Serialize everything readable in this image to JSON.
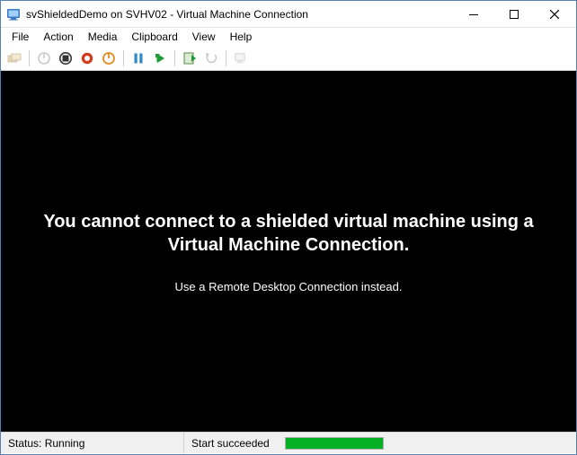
{
  "window": {
    "title": "svShieldedDemo on SVHV02 - Virtual Machine Connection"
  },
  "menu": {
    "file": "File",
    "action": "Action",
    "media": "Media",
    "clipboard": "Clipboard",
    "view": "View",
    "help": "Help"
  },
  "toolbar": {
    "ctrl_alt_del": "Ctrl+Alt+Del",
    "start": "Start",
    "turn_off": "Turn Off",
    "shut_down": "Shut Down",
    "save": "Save",
    "pause": "Pause",
    "reset": "Reset",
    "checkpoint": "Checkpoint",
    "revert": "Revert",
    "enhanced": "Enhanced Session"
  },
  "content": {
    "heading": "You cannot connect to a shielded virtual machine using a Virtual Machine Connection.",
    "subtext": "Use a Remote Desktop Connection instead."
  },
  "status": {
    "state_label": "Status:",
    "state_value": "Running",
    "last_action": "Start succeeded",
    "progress_percent": 100
  }
}
